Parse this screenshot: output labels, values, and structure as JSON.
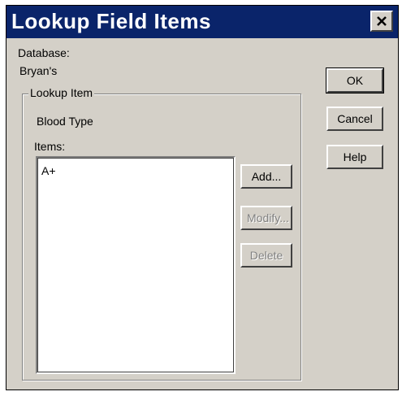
{
  "window": {
    "title": "Lookup Field Items",
    "close_icon": "close-icon"
  },
  "database": {
    "label": "Database:",
    "value": "Bryan's"
  },
  "lookup_item": {
    "group_label": "Lookup Item",
    "value": "Blood Type"
  },
  "items": {
    "label": "Items:",
    "list": [
      "A+"
    ]
  },
  "buttons": {
    "ok": "OK",
    "cancel": "Cancel",
    "help": "Help",
    "add": "Add...",
    "modify": "Modify...",
    "delete": "Delete"
  }
}
